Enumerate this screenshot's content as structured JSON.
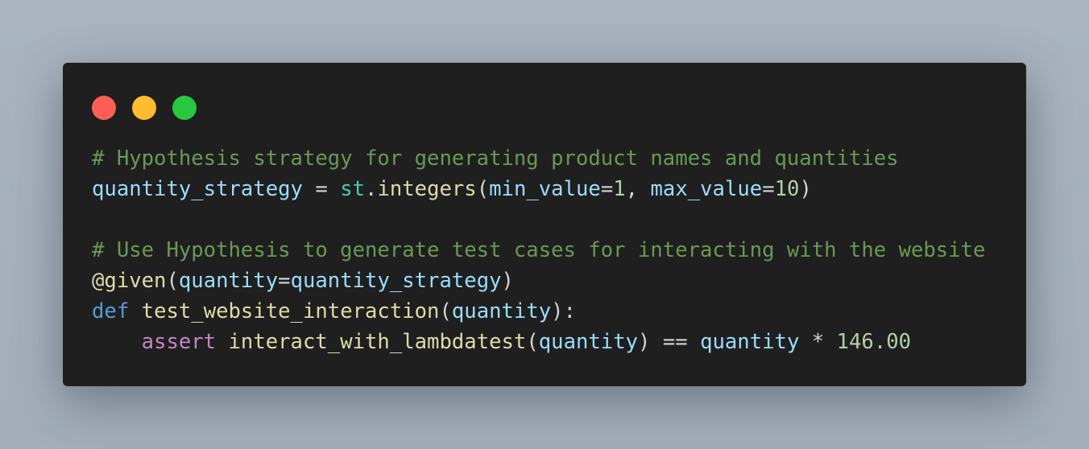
{
  "window": {
    "controls": [
      {
        "name": "close",
        "color": "#ff5f57"
      },
      {
        "name": "minimize",
        "color": "#febc2e"
      },
      {
        "name": "maximize",
        "color": "#28c840"
      }
    ]
  },
  "code": {
    "language": "python",
    "lines": [
      [
        {
          "t": "comment",
          "v": "# Hypothesis strategy for generating product names and quantities"
        }
      ],
      [
        {
          "t": "var",
          "v": "quantity_strategy"
        },
        {
          "t": "punc",
          "v": " = "
        },
        {
          "t": "mod",
          "v": "st"
        },
        {
          "t": "punc",
          "v": "."
        },
        {
          "t": "func",
          "v": "integers"
        },
        {
          "t": "punc",
          "v": "("
        },
        {
          "t": "var",
          "v": "min_value"
        },
        {
          "t": "punc",
          "v": "="
        },
        {
          "t": "num",
          "v": "1"
        },
        {
          "t": "punc",
          "v": ", "
        },
        {
          "t": "var",
          "v": "max_value"
        },
        {
          "t": "punc",
          "v": "="
        },
        {
          "t": "num",
          "v": "10"
        },
        {
          "t": "punc",
          "v": ")"
        }
      ],
      [],
      [
        {
          "t": "comment",
          "v": "# Use Hypothesis to generate test cases for interacting with the website"
        }
      ],
      [
        {
          "t": "func",
          "v": "@given"
        },
        {
          "t": "punc",
          "v": "("
        },
        {
          "t": "var",
          "v": "quantity"
        },
        {
          "t": "punc",
          "v": "="
        },
        {
          "t": "var",
          "v": "quantity_strategy"
        },
        {
          "t": "punc",
          "v": ")"
        }
      ],
      [
        {
          "t": "kw",
          "v": "def"
        },
        {
          "t": "punc",
          "v": " "
        },
        {
          "t": "func",
          "v": "test_website_interaction"
        },
        {
          "t": "punc",
          "v": "("
        },
        {
          "t": "var",
          "v": "quantity"
        },
        {
          "t": "punc",
          "v": "):"
        }
      ],
      [
        {
          "t": "punc",
          "v": "    "
        },
        {
          "t": "ctrl",
          "v": "assert"
        },
        {
          "t": "punc",
          "v": " "
        },
        {
          "t": "func",
          "v": "interact_with_lambdatest"
        },
        {
          "t": "punc",
          "v": "("
        },
        {
          "t": "var",
          "v": "quantity"
        },
        {
          "t": "punc",
          "v": ") == "
        },
        {
          "t": "var",
          "v": "quantity"
        },
        {
          "t": "punc",
          "v": " * "
        },
        {
          "t": "num",
          "v": "146.00"
        }
      ]
    ]
  }
}
